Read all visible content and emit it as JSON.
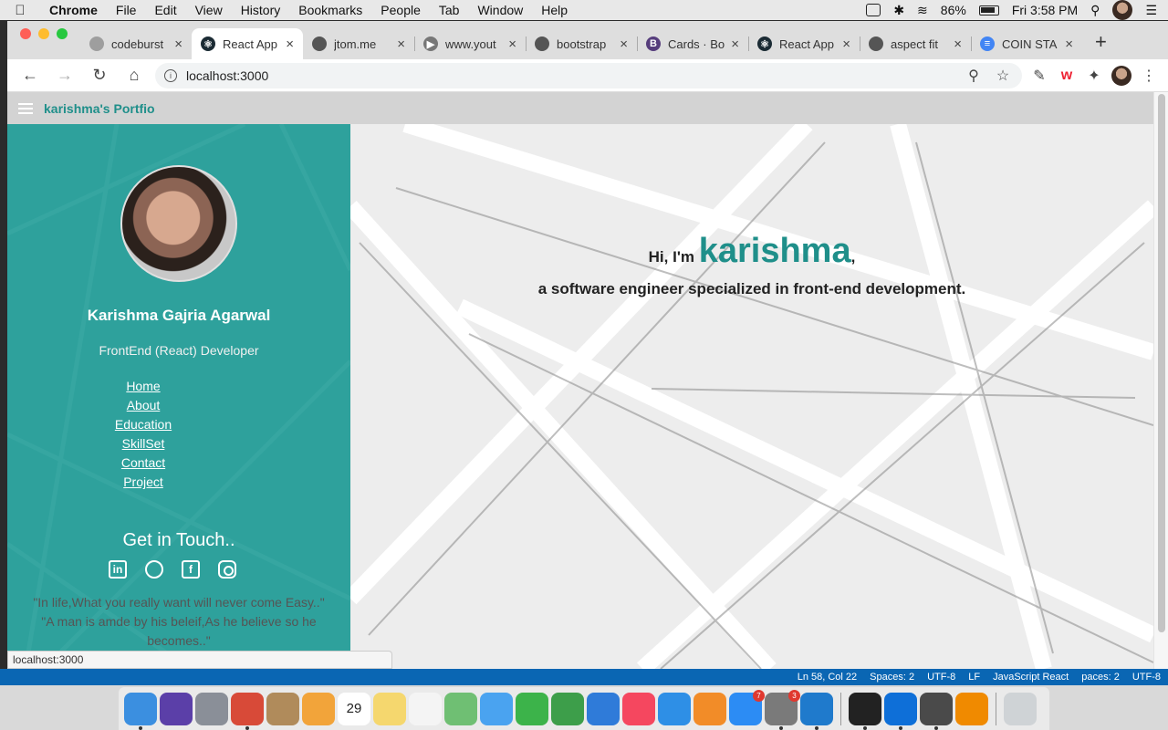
{
  "menubar": {
    "app": "Chrome",
    "items": [
      "File",
      "Edit",
      "View",
      "History",
      "Bookmarks",
      "People",
      "Tab",
      "Window",
      "Help"
    ],
    "battery": "86%",
    "clock": "Fri 3:58 PM"
  },
  "tabs": [
    {
      "title": "codeburst",
      "color": "#9e9e9e",
      "glyph": "",
      "active": false
    },
    {
      "title": "React App",
      "color": "#1b2b34",
      "glyph": "⚛",
      "active": true
    },
    {
      "title": "jtom.me",
      "color": "#555555",
      "glyph": "",
      "active": false
    },
    {
      "title": "www.yout",
      "color": "#777777",
      "glyph": "▶",
      "active": false
    },
    {
      "title": "bootstrap",
      "color": "#555555",
      "glyph": "",
      "active": false
    },
    {
      "title": "Cards · Bo",
      "color": "#563d7c",
      "glyph": "B",
      "active": false
    },
    {
      "title": "React App",
      "color": "#1b2b34",
      "glyph": "⚛",
      "active": false
    },
    {
      "title": "aspect fit",
      "color": "#555555",
      "glyph": "",
      "active": false
    },
    {
      "title": "COIN STA",
      "color": "#4285f4",
      "glyph": "≡",
      "active": false
    }
  ],
  "address": {
    "url": "localhost:3000"
  },
  "app": {
    "brand": "karishma's Portfio"
  },
  "sidebar": {
    "name": "Karishma Gajria Agarwal",
    "role": "FrontEnd (React) Developer",
    "nav": [
      "Home",
      "About",
      "Education",
      "SkillSet",
      "Contact",
      "Project"
    ],
    "touch_heading": "Get in Touch..",
    "socials": [
      "linkedin-icon",
      "github-icon",
      "facebook-icon",
      "instagram-icon"
    ],
    "quote1": "\"In life,What you really want will never come Easy..\"",
    "quote2": "\"A man is amde by his beleif,As he believe so he becomes..\""
  },
  "hero": {
    "greeting": "Hi, I'm",
    "name": "karishma",
    "comma": ",",
    "tagline": "a software engineer specialized in front-end development."
  },
  "status_url": "localhost:3000",
  "vscode_status": {
    "position": "Ln 58, Col 22",
    "spaces": "Spaces: 2",
    "encoding": "UTF-8",
    "eol": "LF",
    "language": "JavaScript React",
    "spaces2": "paces: 2",
    "encoding2": "UTF-8"
  },
  "dock": [
    {
      "name": "finder",
      "color": "#3b8fe0",
      "running": true
    },
    {
      "name": "siri",
      "color": "#5b3fa8",
      "running": false
    },
    {
      "name": "launchpad",
      "color": "#8a8f98",
      "running": false
    },
    {
      "name": "chrome",
      "color": "#d84a38",
      "running": true
    },
    {
      "name": "contacts",
      "color": "#b08b5b",
      "running": false
    },
    {
      "name": "photos",
      "color": "#f2a43a",
      "running": false
    },
    {
      "name": "calendar",
      "color": "#ffffff",
      "running": false,
      "label": "29"
    },
    {
      "name": "notes",
      "color": "#f5d76e",
      "running": false
    },
    {
      "name": "reminders",
      "color": "#f4f4f4",
      "running": false
    },
    {
      "name": "maps",
      "color": "#6fbf73",
      "running": false
    },
    {
      "name": "messages",
      "color": "#4aa3f0",
      "running": false
    },
    {
      "name": "facetime",
      "color": "#3cb34a",
      "running": false
    },
    {
      "name": "numbers",
      "color": "#3d9e4a",
      "running": false
    },
    {
      "name": "keynote",
      "color": "#2f7bd9",
      "running": false
    },
    {
      "name": "music",
      "color": "#f5475f",
      "running": false
    },
    {
      "name": "safari",
      "color": "#2e8fe6",
      "running": false
    },
    {
      "name": "books",
      "color": "#f28c28",
      "running": false
    },
    {
      "name": "app-store",
      "color": "#2c8cf4",
      "running": false,
      "badge": "7"
    },
    {
      "name": "system-preferences",
      "color": "#7a7a7a",
      "running": true,
      "badge": "3"
    },
    {
      "name": "vscode",
      "color": "#1f7acc",
      "running": true
    },
    {
      "name": "terminal",
      "color": "#222222",
      "running": true
    },
    {
      "name": "teamviewer",
      "color": "#0e6fd8",
      "running": true
    },
    {
      "name": "sublime",
      "color": "#4a4a4a",
      "running": true
    },
    {
      "name": "vlc",
      "color": "#f08a00",
      "running": false
    },
    {
      "name": "trash",
      "color": "#cfd3d6",
      "running": false
    }
  ]
}
